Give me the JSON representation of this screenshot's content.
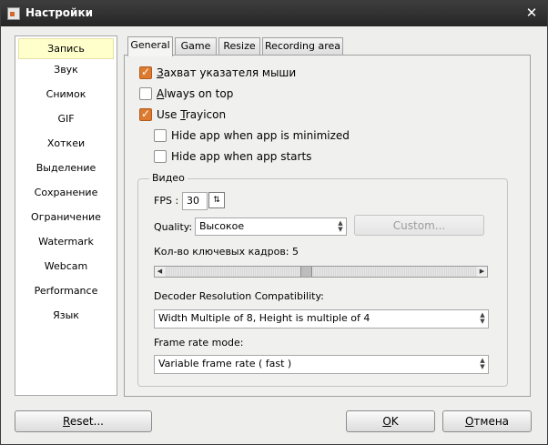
{
  "window": {
    "title": "Настройки",
    "close_glyph": "✕"
  },
  "sidebar": {
    "items": [
      {
        "label": "Запись",
        "selected": true
      },
      {
        "label": "Звук"
      },
      {
        "label": "Снимок"
      },
      {
        "label": "GIF"
      },
      {
        "label": "Хоткеи"
      },
      {
        "label": "Выделение"
      },
      {
        "label": "Сохранение"
      },
      {
        "label": "Ограничение"
      },
      {
        "label": "Watermark"
      },
      {
        "label": "Webcam"
      },
      {
        "label": "Performance"
      },
      {
        "label": "Язык"
      }
    ]
  },
  "tabs": [
    {
      "label": "General",
      "active": true
    },
    {
      "label": "Game"
    },
    {
      "label": "Resize"
    },
    {
      "label": "Recording area"
    }
  ],
  "general": {
    "capture_cursor": {
      "label_pre": "",
      "label_ul": "З",
      "label_post": "ахват указателя мыши",
      "checked": true
    },
    "always_on_top": {
      "label_pre": "",
      "label_ul": "A",
      "label_post": "lways on top",
      "checked": false
    },
    "use_trayicon": {
      "label_pre": "Use ",
      "label_ul": "T",
      "label_post": "rayicon",
      "checked": true
    },
    "hide_minimized": {
      "label": "Hide app when app is minimized",
      "checked": false
    },
    "hide_starts": {
      "label": "Hide app when app starts",
      "checked": false
    }
  },
  "video": {
    "group_title": "Видео",
    "fps_label": "FPS :",
    "fps_value": "30",
    "quality_label": "Quality:",
    "quality_value": "Высокое",
    "custom_button": "Custom...",
    "keyframes_label": "Кол-во ключевых кадров: 5",
    "keyframes_value": 5,
    "decoder_label": "Decoder Resolution Compatibility:",
    "decoder_value": "Width Multiple of 8, Height is multiple of 4",
    "frame_rate_label": "Frame rate mode:",
    "frame_rate_value": "Variable frame rate ( fast )"
  },
  "footer": {
    "reset_pre": "",
    "reset_ul": "R",
    "reset_post": "eset...",
    "ok_pre": "",
    "ok_ul": "O",
    "ok_post": "K",
    "cancel_pre": "",
    "cancel_ul": "О",
    "cancel_post": "тмена"
  }
}
